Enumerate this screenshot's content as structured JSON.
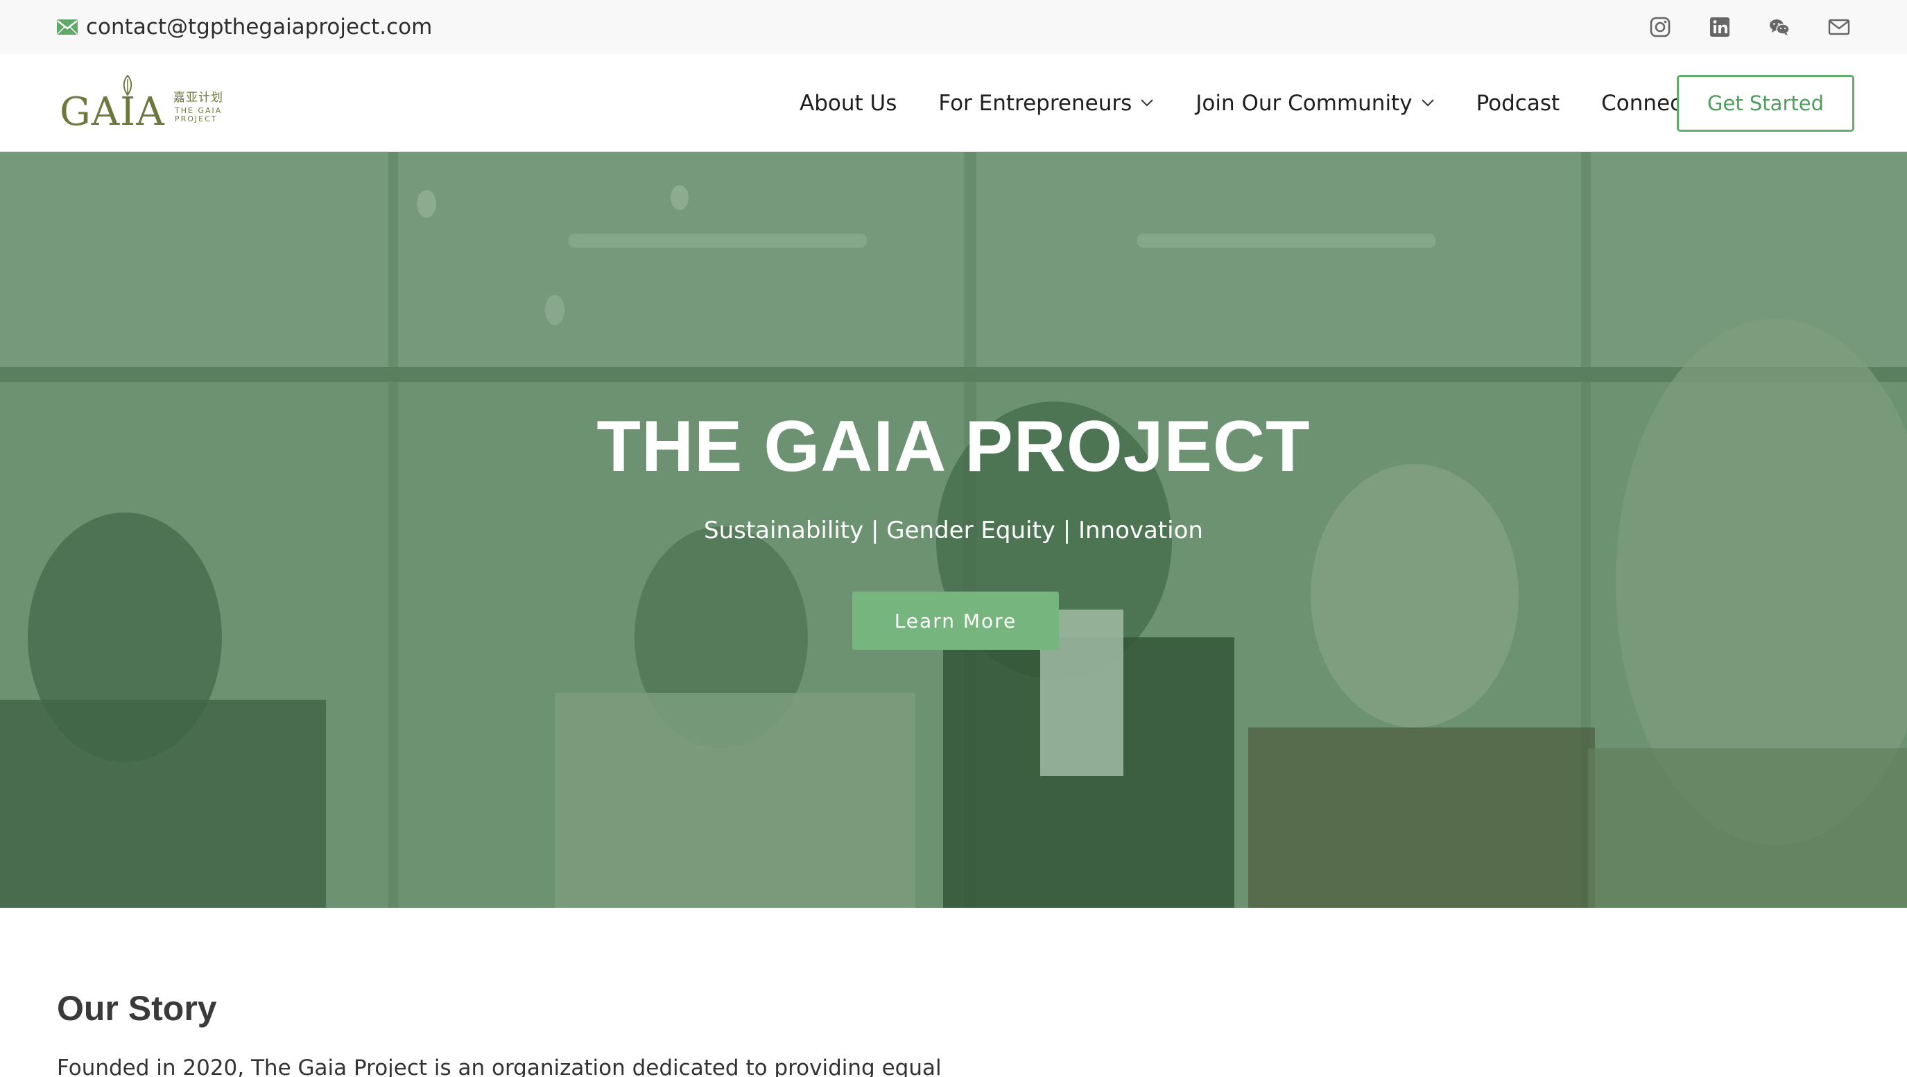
{
  "topbar": {
    "email": "contact@tgpthegaiaproject.com",
    "email_icon": "envelope-icon",
    "socials": [
      {
        "icon": "instagram-icon"
      },
      {
        "icon": "linkedin-icon"
      },
      {
        "icon": "wechat-icon"
      },
      {
        "icon": "mail-icon"
      }
    ]
  },
  "logo": {
    "wordmark": "GAIA",
    "chinese": "嘉亚计划",
    "line1": "THE GAIA",
    "line2": "PROJECT"
  },
  "nav": {
    "items": [
      {
        "label": "About Us",
        "has_dropdown": false
      },
      {
        "label": "For Entrepreneurs",
        "has_dropdown": true
      },
      {
        "label": "Join Our Community",
        "has_dropdown": true
      },
      {
        "label": "Podcast",
        "has_dropdown": false
      },
      {
        "label": "Connect",
        "has_dropdown": false
      }
    ],
    "cta_label": "Get Started"
  },
  "hero": {
    "title": "THE GAIA PROJECT",
    "tagline": "Sustainability | Gender Equity | Innovation",
    "button_label": "Learn More"
  },
  "story": {
    "title": "Our Story",
    "text": "Founded in 2020, The Gaia Project is an organization dedicated to providing equal"
  },
  "colors": {
    "brand_green": "#76b57d",
    "cta_border": "#5fae6a",
    "logo_olive": "#6b7a3c",
    "topbar_bg": "#f8f8f8"
  }
}
